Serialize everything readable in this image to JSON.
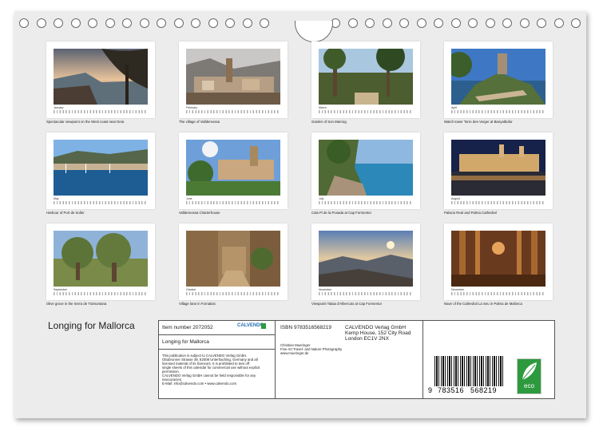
{
  "calendar": {
    "title": "Longing for Mallorca",
    "months": [
      {
        "month": "January",
        "caption": "Spectacular viewpoint on the West coast near Deia"
      },
      {
        "month": "February",
        "caption": "The village of Valldemossa"
      },
      {
        "month": "March",
        "caption": "Garden of Son Marroig"
      },
      {
        "month": "April",
        "caption": "Watch tower Torre des Verger at Banyalbufar"
      },
      {
        "month": "May",
        "caption": "Harbour of Port de Soller"
      },
      {
        "month": "June",
        "caption": "Valldemossa Charterhouse"
      },
      {
        "month": "July",
        "caption": "Cala Pi de la Posada at Cap Formentor"
      },
      {
        "month": "August",
        "caption": "Palacio Real and Palma Cathedral"
      },
      {
        "month": "September",
        "caption": "Olive grove in the Serra de Tramuntana"
      },
      {
        "month": "October",
        "caption": "Village lane in Fornalutx"
      },
      {
        "month": "November",
        "caption": "Viewpoint Talaia d'Albercutx at Cap Formentor"
      },
      {
        "month": "December",
        "caption": "Nave of the Cathedral La Seu in Palma de Mallorca"
      }
    ]
  },
  "product": {
    "item_number": "Item number 2072052",
    "name": "Longing for Mallorca",
    "isbn": "ISBN 9783516568219",
    "publisher_lines": [
      "CALVENDO Verlag GmbH",
      "Kemp House, 152 City Road",
      "London EC1V 2NX"
    ],
    "author_lines": [
      "Christian Mueringer",
      "Fine Art Travel- and Nature Photography",
      "www.mueringer.de"
    ],
    "legal_lines": [
      "This publication is subject to CALVENDO Verlag GmbH,",
      "Ottobrunner Strasse 39, 82008 Unterhaching, Germany and all",
      "licensed material of its licensors. It is prohibited to tear off",
      "single sheets of this calendar for commercial use without explicit",
      "permission.",
      "CALVENDO Verlag GmbH cannot be held responsible for any",
      "inaccuracies.",
      "E-Mail: info@calvendo.com • www.calvendo.com"
    ],
    "barcode_digits": {
      "first": "9",
      "group1": "783516",
      "group2": "568219"
    },
    "brand": "CALVENDO",
    "eco_label": "eco"
  },
  "colors": {
    "sheet": "#ececec",
    "eco_green": "#2e9a3e",
    "brand_blue": "#1f6fb3"
  }
}
